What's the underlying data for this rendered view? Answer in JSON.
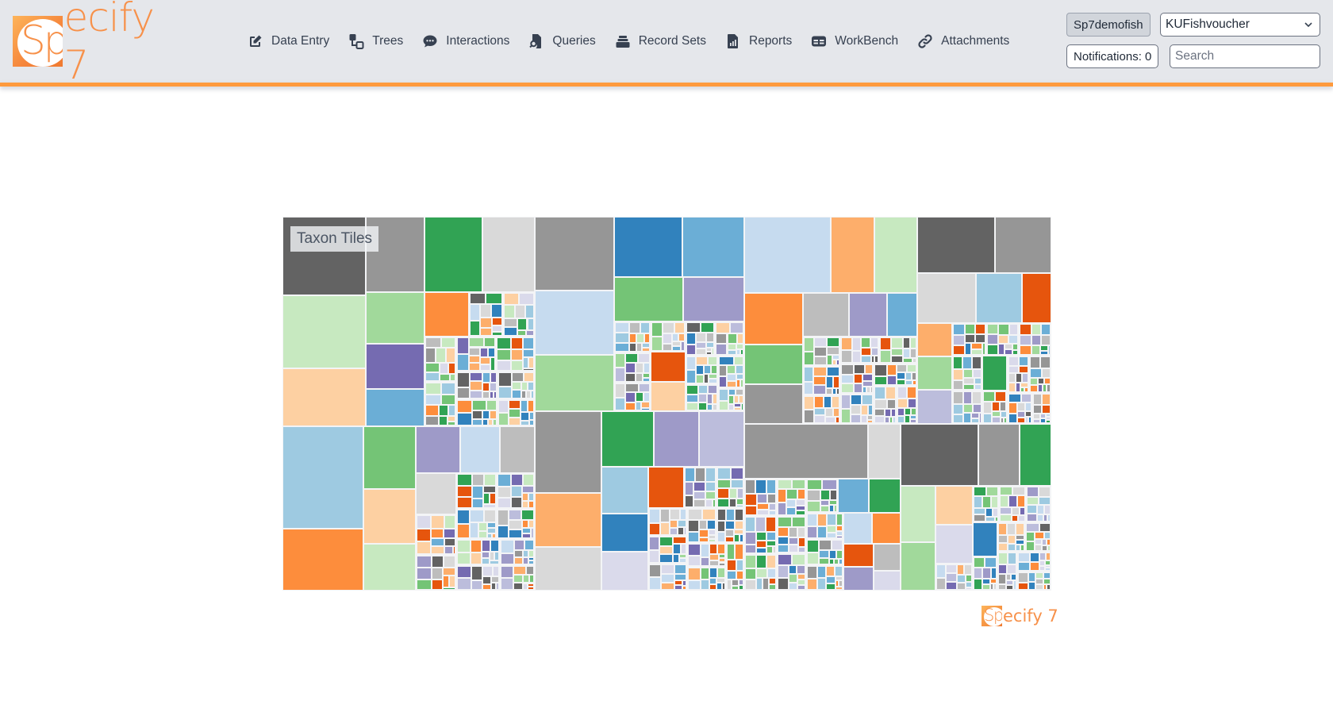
{
  "app": {
    "logo_prefix": "Sp",
    "logo_suffix": "ecify 7",
    "brand_color": "#f7914a",
    "accent_rule_color": "#ff9a3d"
  },
  "nav": {
    "items": [
      {
        "label": "Data Entry",
        "icon": "edit-icon"
      },
      {
        "label": "Trees",
        "icon": "tree-icon"
      },
      {
        "label": "Interactions",
        "icon": "chat-bubble-icon"
      },
      {
        "label": "Queries",
        "icon": "query-icon"
      },
      {
        "label": "Record Sets",
        "icon": "record-sets-icon"
      },
      {
        "label": "Reports",
        "icon": "report-icon"
      },
      {
        "label": "WorkBench",
        "icon": "workbench-icon"
      },
      {
        "label": "Attachments",
        "icon": "link-icon"
      }
    ]
  },
  "user": {
    "username": "Sp7demofish",
    "collection": "KUFishvoucher",
    "notifications_label": "Notifications: 0",
    "search_placeholder": "Search",
    "search_value": ""
  },
  "treemap": {
    "title": "Taxon Tiles",
    "palette": [
      "#3182bd",
      "#6baed6",
      "#9ecae1",
      "#c6dbef",
      "#e6550d",
      "#fd8d3c",
      "#fdae6b",
      "#fdd0a2",
      "#31a354",
      "#74c476",
      "#a1d99b",
      "#c7e9c0",
      "#756bb1",
      "#9e9ac8",
      "#bcbddc",
      "#dadaeb",
      "#636363",
      "#969696",
      "#bdbdbd",
      "#d9d9d9"
    ],
    "seed": 7,
    "groups": [
      {
        "weight": 3.2,
        "leaves": [
          [
            17,
            38
          ],
          [
            19,
            10
          ],
          [
            1,
            6
          ],
          [
            3,
            5
          ],
          [
            4,
            4
          ],
          [
            5,
            5
          ],
          [
            8,
            6
          ],
          [
            13,
            4
          ],
          [
            15,
            3
          ],
          [
            18,
            4
          ]
        ]
      },
      {
        "weight": 6.5,
        "leaves": [
          [
            16,
            30
          ],
          [
            17,
            20
          ],
          [
            19,
            18
          ],
          [
            11,
            28
          ],
          [
            7,
            22
          ],
          [
            8,
            20
          ],
          [
            10,
            14
          ],
          [
            12,
            12
          ],
          [
            1,
            10
          ],
          [
            5,
            9
          ]
        ]
      },
      {
        "weight": 5.1,
        "leaves": [
          [
            2,
            40
          ],
          [
            5,
            24
          ],
          [
            7,
            14
          ],
          [
            9,
            16
          ],
          [
            11,
            12
          ],
          [
            13,
            10
          ],
          [
            3,
            9
          ],
          [
            18,
            8
          ],
          [
            19,
            8
          ]
        ]
      },
      {
        "weight": 3.4,
        "leaves": [
          [
            16,
            30
          ],
          [
            17,
            22
          ],
          [
            19,
            20
          ],
          [
            2,
            16
          ],
          [
            4,
            10
          ],
          [
            6,
            8
          ],
          [
            10,
            8
          ],
          [
            14,
            8
          ],
          [
            8,
            6
          ]
        ]
      },
      {
        "weight": 3.1,
        "leaves": [
          [
            16,
            34
          ],
          [
            17,
            18
          ],
          [
            8,
            14
          ],
          [
            10,
            12
          ],
          [
            11,
            14
          ],
          [
            7,
            10
          ],
          [
            15,
            10
          ],
          [
            0,
            6
          ]
        ]
      },
      {
        "weight": 5.0,
        "leaves": [
          [
            17,
            34
          ],
          [
            0,
            24
          ],
          [
            1,
            22
          ],
          [
            3,
            30
          ],
          [
            9,
            18
          ],
          [
            10,
            26
          ],
          [
            13,
            16
          ],
          [
            4,
            6
          ],
          [
            7,
            6
          ]
        ]
      },
      {
        "weight": 4.4,
        "leaves": [
          [
            3,
            40
          ],
          [
            6,
            20
          ],
          [
            5,
            18
          ],
          [
            11,
            20
          ],
          [
            9,
            14
          ],
          [
            17,
            14
          ],
          [
            18,
            12
          ],
          [
            13,
            10
          ],
          [
            1,
            8
          ]
        ]
      },
      {
        "weight": 4.6,
        "leaves": [
          [
            17,
            30
          ],
          [
            19,
            16
          ],
          [
            6,
            20
          ],
          [
            8,
            16
          ],
          [
            13,
            14
          ],
          [
            14,
            14
          ],
          [
            2,
            12
          ],
          [
            0,
            10
          ],
          [
            15,
            10
          ],
          [
            4,
            8
          ]
        ]
      }
    ],
    "small_tile_count": 900
  }
}
